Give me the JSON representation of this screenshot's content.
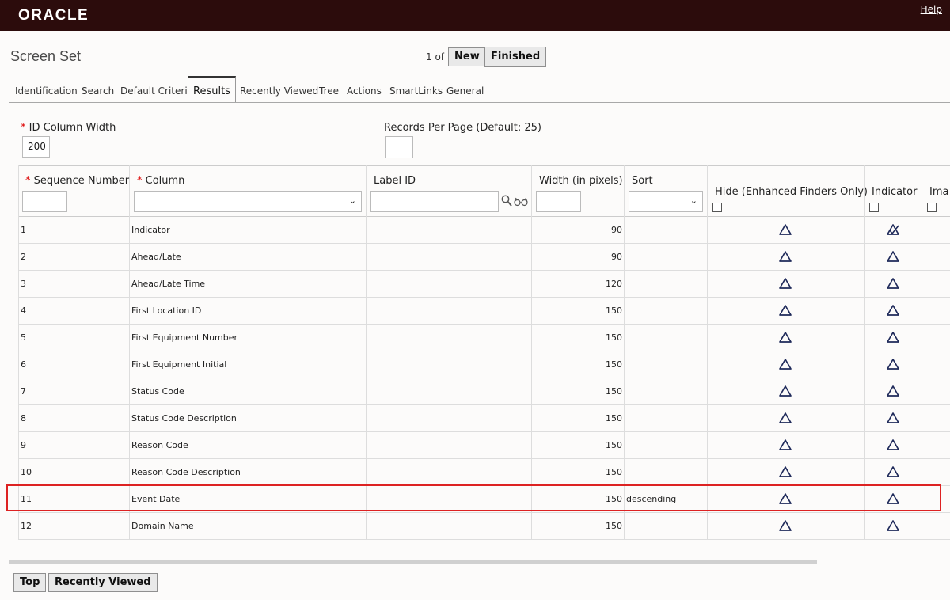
{
  "app": {
    "logo": "ORACLE",
    "help": "Help"
  },
  "page": {
    "title": "Screen Set",
    "pager": "1 of 1"
  },
  "buttons": {
    "new": "New",
    "finished": "Finished",
    "top": "Top",
    "recently_viewed": "Recently Viewed"
  },
  "tabs": [
    "Identification",
    "Search",
    "Default Criteria",
    "Results",
    "Recently Viewed",
    "Tree",
    "Actions",
    "SmartLinks",
    "General"
  ],
  "form": {
    "id_col_width_label": "ID Column Width",
    "id_col_width_value": "200",
    "records_per_page_label": "Records Per Page (Default: 25)",
    "records_per_page_value": "",
    "required_mark": "*"
  },
  "table": {
    "headers": {
      "seq": "Sequence Number",
      "column": "Column",
      "label_id": "Label ID",
      "width": "Width (in pixels)",
      "sort": "Sort",
      "hide": "Hide (Enhanced Finders Only)",
      "indicator": "Indicator",
      "image": "Ima"
    },
    "rows": [
      {
        "seq": "1",
        "column": "Indicator",
        "width": "90",
        "sort": "",
        "indicator_checked": true
      },
      {
        "seq": "2",
        "column": "Ahead/Late",
        "width": "90",
        "sort": "",
        "indicator_checked": false
      },
      {
        "seq": "3",
        "column": "Ahead/Late Time",
        "width": "120",
        "sort": "",
        "indicator_checked": false
      },
      {
        "seq": "4",
        "column": "First Location ID",
        "width": "150",
        "sort": "",
        "indicator_checked": false
      },
      {
        "seq": "5",
        "column": "First Equipment Number",
        "width": "150",
        "sort": "",
        "indicator_checked": false
      },
      {
        "seq": "6",
        "column": "First Equipment Initial",
        "width": "150",
        "sort": "",
        "indicator_checked": false
      },
      {
        "seq": "7",
        "column": "Status Code",
        "width": "150",
        "sort": "",
        "indicator_checked": false
      },
      {
        "seq": "8",
        "column": "Status Code Description",
        "width": "150",
        "sort": "",
        "indicator_checked": false
      },
      {
        "seq": "9",
        "column": "Reason Code",
        "width": "150",
        "sort": "",
        "indicator_checked": false
      },
      {
        "seq": "10",
        "column": "Reason Code Description",
        "width": "150",
        "sort": "",
        "indicator_checked": false
      },
      {
        "seq": "11",
        "column": "Event Date",
        "width": "150",
        "sort": "descending",
        "indicator_checked": false
      },
      {
        "seq": "12",
        "column": "Domain Name",
        "width": "150",
        "sort": "",
        "indicator_checked": false
      }
    ]
  },
  "colors": {
    "topbar": "#2c0c0c",
    "highlight": "#dd2222",
    "icon": "#1f2a5a"
  }
}
